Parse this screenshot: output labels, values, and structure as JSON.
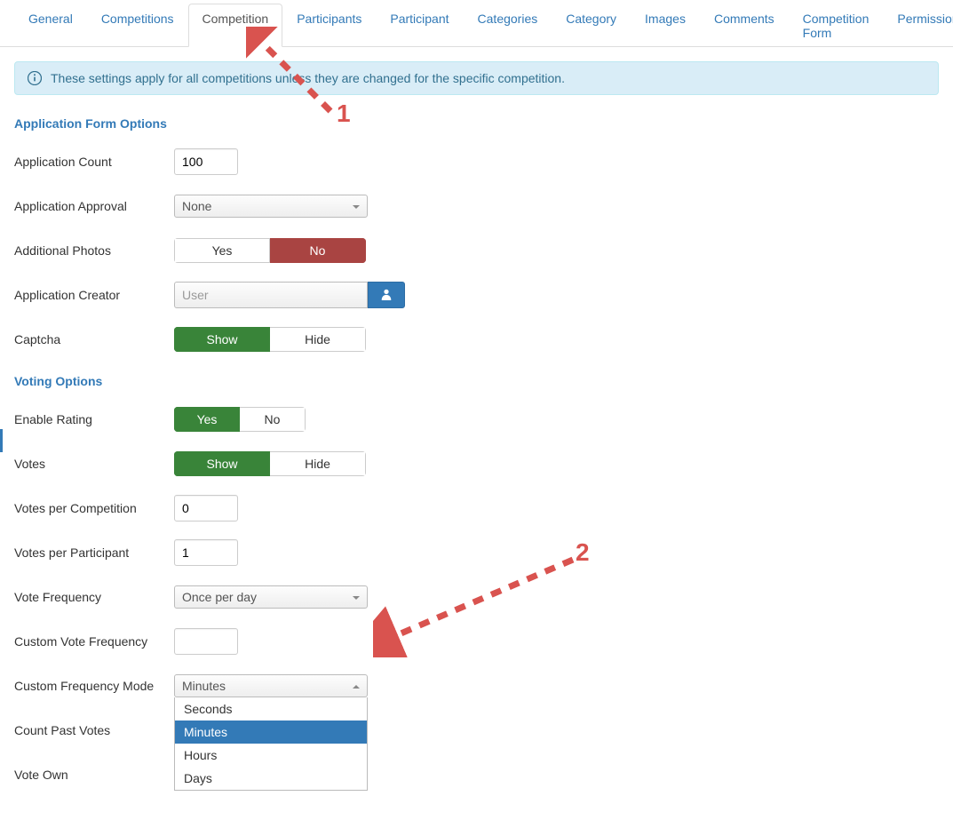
{
  "tabs": [
    {
      "label": "General"
    },
    {
      "label": "Competitions"
    },
    {
      "label": "Competition"
    },
    {
      "label": "Participants"
    },
    {
      "label": "Participant"
    },
    {
      "label": "Categories"
    },
    {
      "label": "Category"
    },
    {
      "label": "Images"
    },
    {
      "label": "Comments"
    },
    {
      "label": "Competition Form"
    },
    {
      "label": "Permissions"
    }
  ],
  "alert": {
    "text": "These settings apply for all competitions unless they are changed for the specific competition."
  },
  "sections": {
    "app": {
      "title": "Application Form Options",
      "count_label": "Application Count",
      "count_value": "100",
      "approval_label": "Application Approval",
      "approval_value": "None",
      "photos_label": "Additional Photos",
      "photos_yes": "Yes",
      "photos_no": "No",
      "creator_label": "Application Creator",
      "creator_placeholder": "User",
      "captcha_label": "Captcha",
      "captcha_show": "Show",
      "captcha_hide": "Hide"
    },
    "vote": {
      "title": "Voting Options",
      "rating_label": "Enable Rating",
      "rating_yes": "Yes",
      "rating_no": "No",
      "votes_label": "Votes",
      "votes_show": "Show",
      "votes_hide": "Hide",
      "vpc_label": "Votes per Competition",
      "vpc_value": "0",
      "vpp_label": "Votes per Participant",
      "vpp_value": "1",
      "freq_label": "Vote Frequency",
      "freq_value": "Once per day",
      "custom_freq_label": "Custom Vote Frequency",
      "custom_freq_value": "",
      "mode_label": "Custom Frequency Mode",
      "mode_value": "Minutes",
      "mode_options": [
        "Seconds",
        "Minutes",
        "Hours",
        "Days"
      ],
      "past_label": "Count Past Votes",
      "own_label": "Vote Own"
    }
  },
  "annotations": {
    "one": "1",
    "two": "2"
  }
}
